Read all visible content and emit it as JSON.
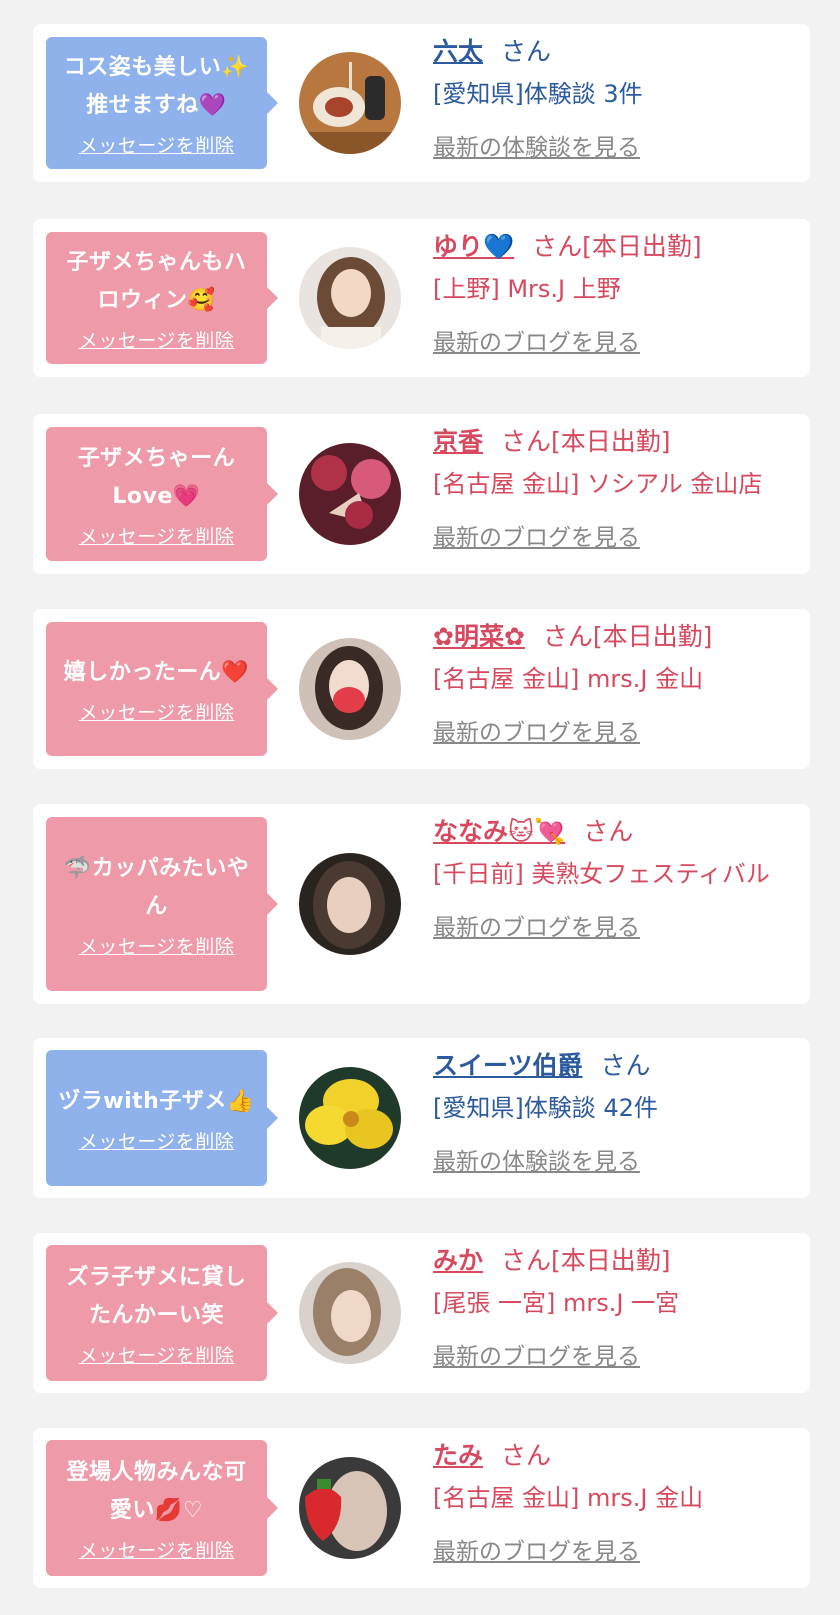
{
  "cards": [
    {
      "message_lines": [
        "コス姿も美しい✨",
        "推せますね💜"
      ],
      "delete_label": "メッセージを削除",
      "name": "六太",
      "san_label": "さん",
      "sub": "[愛知県]体験談 3件",
      "more": "最新の体験談を見る",
      "theme": "blue"
    },
    {
      "message_lines": [
        "子ザメちゃんもハ",
        "ロウィン🥰"
      ],
      "delete_label": "メッセージを削除",
      "name": "ゆり💙",
      "san_label": "さん[本日出勤]",
      "sub": "[上野] Mrs.J 上野",
      "more": "最新のブログを見る",
      "theme": "pink"
    },
    {
      "message_lines": [
        "子ザメちゃーん",
        "Love💗"
      ],
      "delete_label": "メッセージを削除",
      "name": "京香",
      "san_label": "さん[本日出勤]",
      "sub": "[名古屋 金山] ソシアル 金山店",
      "more": "最新のブログを見る",
      "theme": "pink"
    },
    {
      "message_lines": [
        "嬉しかったーん❤️"
      ],
      "delete_label": "メッセージを削除",
      "name": "✿明菜✿",
      "san_label": "さん[本日出勤]",
      "sub": "[名古屋 金山] mrs.J 金山",
      "more": "最新のブログを見る",
      "theme": "pink"
    },
    {
      "message_lines": [
        "🦈カッパみたいや",
        "ん"
      ],
      "delete_label": "メッセージを削除",
      "name": "ななみ🐱💘",
      "san_label": "さん",
      "sub": "[千日前] 美熟女フェスティバル",
      "more": "最新のブログを見る",
      "theme": "pink"
    },
    {
      "message_lines": [
        "ヅラwith子ザメ👍"
      ],
      "delete_label": "メッセージを削除",
      "name": "スイーツ伯爵",
      "san_label": "さん",
      "sub": "[愛知県]体験談 42件",
      "more": "最新の体験談を見る",
      "theme": "blue"
    },
    {
      "message_lines": [
        "ズラ子ザメに貸し",
        "たんかーい笑"
      ],
      "delete_label": "メッセージを削除",
      "name": "みか",
      "san_label": "さん[本日出勤]",
      "sub": "[尾張 一宮] mrs.J 一宮",
      "more": "最新のブログを見る",
      "theme": "pink"
    },
    {
      "message_lines": [
        "登場人物みんな可",
        "愛い💋♡"
      ],
      "delete_label": "メッセージを削除",
      "name": "たみ",
      "san_label": "さん",
      "sub": "[名古屋 金山] mrs.J 金山",
      "more": "最新のブログを見る",
      "theme": "pink"
    }
  ],
  "colors": {
    "page_background": "#f2f2f2",
    "card_background": "#ffffff",
    "bubble_blue": "#8fb1ec",
    "bubble_pink": "#ee9aa8",
    "text_blue": "#2c5a9e",
    "text_pink": "#d6495e",
    "link_gray": "#888888"
  },
  "avatars": [
    "dessert-plate-photo",
    "woman-long-hair-photo",
    "kimono-fan-photo",
    "masked-woman-photo",
    "woman-closeup-photo",
    "yellow-flower-photo",
    "blonde-woman-photo",
    "strawberry-face-photo"
  ]
}
